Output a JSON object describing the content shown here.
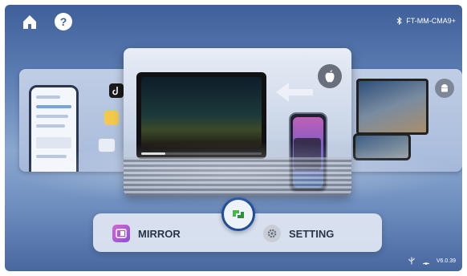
{
  "topbar": {
    "home_icon": "home-icon",
    "help_label": "?",
    "bluetooth_icon": "bluetooth-icon",
    "device_name": "FT-MM-CMA9+"
  },
  "cards": {
    "main_badge_icon": "apple-icon",
    "right_badge_icon": "android-icon"
  },
  "modes": {
    "mirror_label": "MIRROR",
    "setting_label": "SETTING"
  },
  "status": {
    "usb_icon": "usb-icon",
    "cast_icon": "cast-icon",
    "version": "V6.0.39"
  },
  "colors": {
    "accent": "#1f4d9a",
    "mirror": "#b35ad2",
    "panel": "#e2e8f4"
  }
}
